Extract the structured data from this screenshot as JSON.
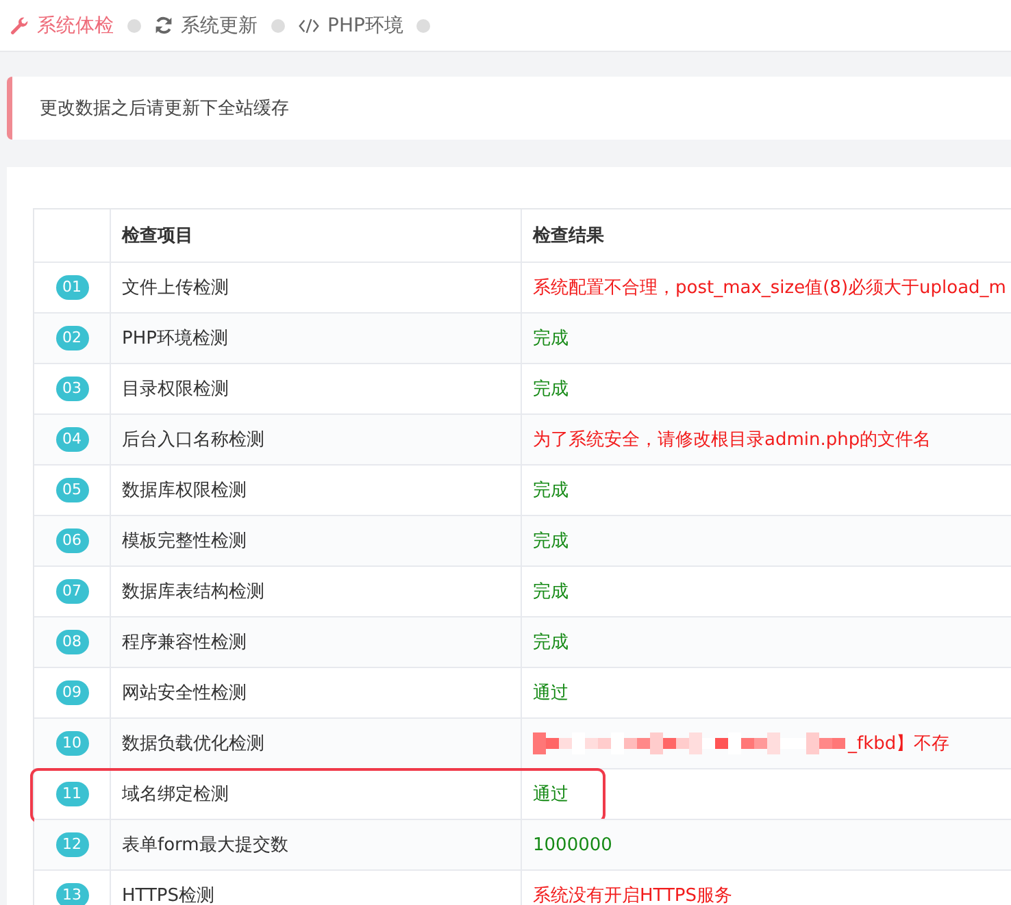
{
  "tabs": [
    {
      "label": "系统体检",
      "selected": true
    },
    {
      "label": "系统更新",
      "selected": false
    },
    {
      "label": "PHP环境",
      "selected": false
    }
  ],
  "notice": "更改数据之后请更新下全站缓存",
  "table": {
    "columns": [
      "检查项目",
      "检查结果"
    ],
    "rows": [
      {
        "number": "01",
        "item": "文件上传检测",
        "result": "系统配置不合理，post_max_size值(8)必须大于upload_m",
        "color": "#f21c1c",
        "redacted": false,
        "highlighted": false
      },
      {
        "number": "02",
        "item": "PHP环境检测",
        "result": "完成",
        "color": "#168a16",
        "redacted": false,
        "highlighted": false
      },
      {
        "number": "03",
        "item": "目录权限检测",
        "result": "完成",
        "color": "#168a16",
        "redacted": false,
        "highlighted": false
      },
      {
        "number": "04",
        "item": "后台入口名称检测",
        "result": "为了系统安全，请修改根目录admin.php的文件名",
        "color": "#f21c1c",
        "redacted": false,
        "highlighted": false
      },
      {
        "number": "05",
        "item": "数据库权限检测",
        "result": "完成",
        "color": "#168a16",
        "redacted": false,
        "highlighted": false
      },
      {
        "number": "06",
        "item": "模板完整性检测",
        "result": "完成",
        "color": "#168a16",
        "redacted": false,
        "highlighted": false
      },
      {
        "number": "07",
        "item": "数据库表结构检测",
        "result": "完成",
        "color": "#168a16",
        "redacted": false,
        "highlighted": false
      },
      {
        "number": "08",
        "item": "程序兼容性检测",
        "result": "完成",
        "color": "#168a16",
        "redacted": false,
        "highlighted": false
      },
      {
        "number": "09",
        "item": "网站安全性检测",
        "result": "通过",
        "color": "#168a16",
        "redacted": false,
        "highlighted": false
      },
      {
        "number": "10",
        "item": "数据负载优化检测",
        "result": "_fkbd】不存",
        "color": "#f21c1c",
        "redacted": true,
        "highlighted": false
      },
      {
        "number": "11",
        "item": "域名绑定检测",
        "result": "通过",
        "color": "#168a16",
        "redacted": false,
        "highlighted": true
      },
      {
        "number": "12",
        "item": "表单form最大提交数",
        "result": "1000000",
        "color": "#168a16",
        "redacted": false,
        "highlighted": false
      },
      {
        "number": "13",
        "item": "HTTPS检测",
        "result": "系统没有开启HTTPS服务",
        "color": "#f21c1c",
        "redacted": false,
        "highlighted": false
      }
    ]
  }
}
